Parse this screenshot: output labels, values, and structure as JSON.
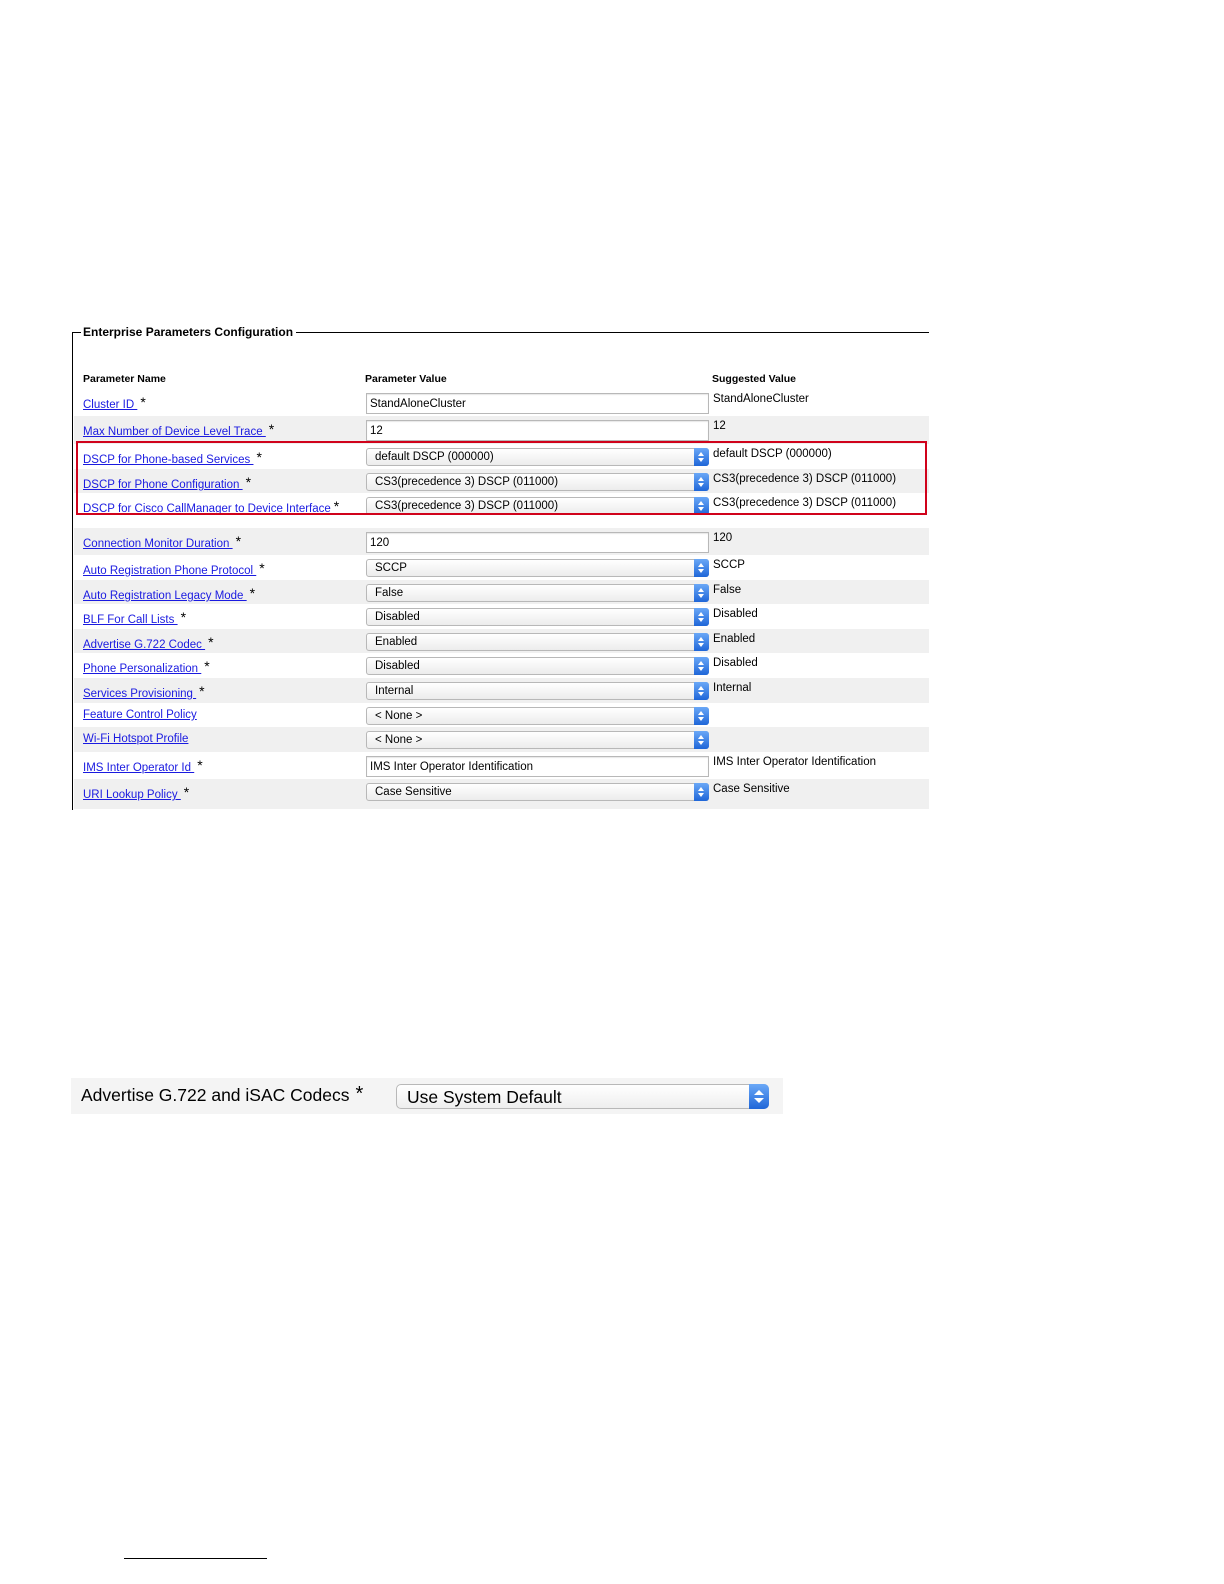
{
  "panel": {
    "title": "Enterprise Parameters Configuration",
    "headers": {
      "name": "Parameter Name",
      "value": "Parameter Value",
      "suggested": "Suggested Value"
    },
    "required_mark": "*",
    "rows": [
      {
        "name": "Cluster ID ",
        "required": true,
        "type": "text",
        "value": "StandAloneCluster",
        "suggested": "StandAloneCluster"
      },
      {
        "name": "Max Number of Device Level Trace ",
        "required": true,
        "type": "text",
        "value": "12",
        "suggested": "12"
      },
      {
        "name": "DSCP for Phone-based Services ",
        "required": true,
        "type": "select",
        "value": "default DSCP (000000)",
        "suggested": "default DSCP (000000)"
      },
      {
        "name": "DSCP for Phone Configuration ",
        "required": true,
        "type": "select",
        "value": "CS3(precedence 3) DSCP (011000)",
        "suggested": "CS3(precedence 3) DSCP (011000)"
      },
      {
        "name": "DSCP for Cisco CallManager to Device Interface",
        "required": true,
        "type": "select",
        "value": "CS3(precedence 3) DSCP (011000)",
        "suggested": "CS3(precedence 3) DSCP (011000)"
      },
      {
        "name": "Connection Monitor Duration ",
        "required": true,
        "type": "text",
        "value": "120",
        "suggested": "120"
      },
      {
        "name": "Auto Registration Phone Protocol ",
        "required": true,
        "type": "select",
        "value": "SCCP",
        "suggested": "SCCP"
      },
      {
        "name": "Auto Registration Legacy Mode ",
        "required": true,
        "type": "select",
        "value": "False",
        "suggested": "False"
      },
      {
        "name": "BLF For Call Lists ",
        "required": true,
        "type": "select",
        "value": "Disabled",
        "suggested": "Disabled"
      },
      {
        "name": "Advertise G.722 Codec ",
        "required": true,
        "type": "select",
        "value": "Enabled",
        "suggested": "Enabled"
      },
      {
        "name": "Phone Personalization ",
        "required": true,
        "type": "select",
        "value": "Disabled",
        "suggested": "Disabled"
      },
      {
        "name": "Services Provisioning ",
        "required": true,
        "type": "select",
        "value": "Internal",
        "suggested": "Internal"
      },
      {
        "name": "Feature Control Policy",
        "required": false,
        "type": "select",
        "value": "< None >",
        "suggested": ""
      },
      {
        "name": "Wi-Fi Hotspot Profile",
        "required": false,
        "type": "select",
        "value": "< None >",
        "suggested": ""
      },
      {
        "name": "IMS Inter Operator Id ",
        "required": true,
        "type": "text",
        "value": "IMS Inter Operator Identification",
        "suggested": "IMS Inter Operator Identification"
      },
      {
        "name": "URI Lookup Policy ",
        "required": true,
        "type": "select",
        "value": "Case Sensitive",
        "suggested": "Case Sensitive"
      }
    ]
  },
  "codec_setting": {
    "label": "Advertise G.722 and iSAC Codecs",
    "required_mark": "*",
    "value": "Use System Default"
  },
  "colors": {
    "link": "#1a1ae0",
    "highlight_border": "#d0021b",
    "row_shade": "#f0f0f0",
    "select_button": "#1f66d8"
  }
}
